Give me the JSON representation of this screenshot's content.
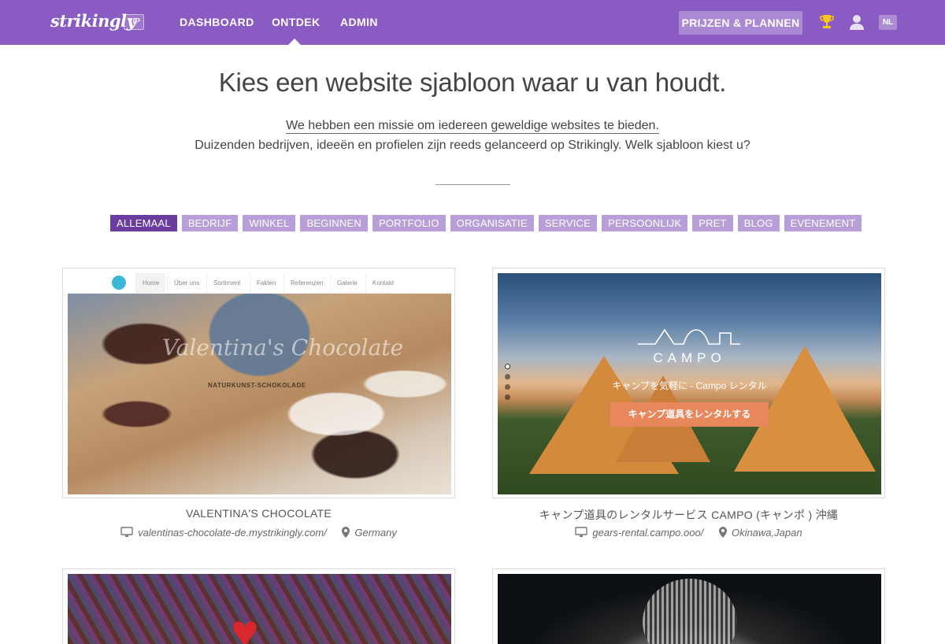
{
  "brand": {
    "logo": "strikingly",
    "badge": "VIP"
  },
  "nav": {
    "items": [
      {
        "label": "DASHBOARD"
      },
      {
        "label": "ONTDEK"
      },
      {
        "label": "ADMIN"
      }
    ],
    "active": "ONTDEK",
    "plans_button": "PRIJZEN & PLANNEN",
    "language": "NL",
    "icons": [
      "trophy-icon",
      "user-icon"
    ]
  },
  "hero": {
    "headline": "Kies een website sjabloon waar u van houdt.",
    "mission": "We hebben een missie om iedereen geweldige websites te bieden.",
    "subline": "Duizenden bedrijven, ideeën en profielen zijn reeds gelanceerd op Strikingly. Welk sjabloon kiest u?"
  },
  "filters": {
    "active": "ALLEMAAL",
    "items": [
      "ALLEMAAL",
      "BEDRIJF",
      "WINKEL",
      "BEGINNEN",
      "PORTFOLIO",
      "ORGANISATIE",
      "SERVICE",
      "PERSOONLIJK",
      "PRET",
      "BLOG",
      "EVENEMENT"
    ]
  },
  "templates": [
    {
      "title": "VALENTINA'S CHOCOLATE",
      "url": "valentinas-chocolate-de.mystrikingly.com/",
      "location": "Germany",
      "preview": {
        "nav": [
          "Home",
          "Über uns",
          "Sortiment",
          "Fakten",
          "Referenzen",
          "Galerie",
          "Kontakt"
        ],
        "script_title": "Valentina's Chocolate",
        "subtitle": "NATURKUNST-SCHOKOLADE"
      }
    },
    {
      "title": "キャンプ道具のレンタルサービス CAMPO (キャンポ ) 沖縄",
      "url": "gears-rental.campo.ooo/",
      "location": "Okinawa,Japan",
      "preview": {
        "brand": "CAMPO",
        "tagline": "キャンプを気軽に - Campo レンタル",
        "button": "キャンプ道具をレンタルする"
      }
    },
    {
      "title": "",
      "url": "",
      "location": ""
    },
    {
      "title": "",
      "url": "",
      "location": ""
    }
  ],
  "colors": {
    "topbar": "#8a5bc2",
    "tag": "#b89fd9",
    "tag_active": "#6a3d9e",
    "campo_button": "#e8875c"
  }
}
